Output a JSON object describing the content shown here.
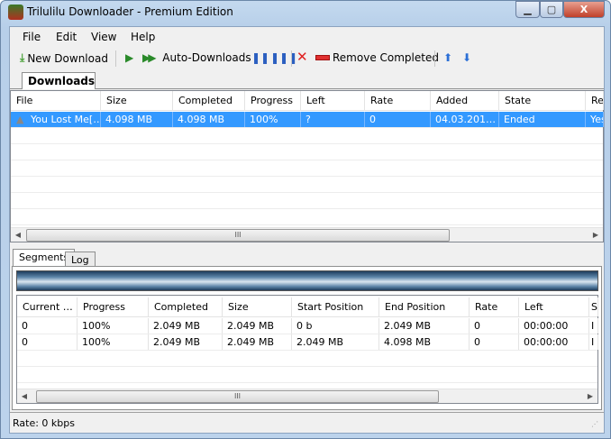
{
  "window": {
    "title": "Trilulilu Downloader - Premium Edition",
    "minimize": "▁",
    "maximize": "▢",
    "close": "X"
  },
  "menu": [
    "File",
    "Edit",
    "View",
    "Help"
  ],
  "toolbar": {
    "new_download": "New Download",
    "auto_downloads": "Auto-Downloads",
    "remove_completed": "Remove Completed"
  },
  "downloads_tab": "Downloads",
  "downloads": {
    "columns": [
      "File",
      "Size",
      "Completed",
      "Progress",
      "Left",
      "Rate",
      "Added",
      "State",
      "Re"
    ],
    "rows": [
      [
        "You Lost Me[…",
        "4.098 MB",
        "4.098 MB",
        "100%",
        "?",
        "0",
        "04.03.201…",
        "Ended",
        "Yes"
      ]
    ]
  },
  "bottom_tabs": [
    "Segments",
    "Log"
  ],
  "segments": {
    "columns": [
      "Current …",
      "Progress",
      "Completed",
      "Size",
      "Start Position",
      "End Position",
      "Rate",
      "Left",
      "S"
    ],
    "rows": [
      [
        "0",
        "100%",
        "2.049 MB",
        "2.049 MB",
        "0 b",
        "2.049 MB",
        "0",
        "00:00:00",
        "I"
      ],
      [
        "0",
        "100%",
        "2.049 MB",
        "2.049 MB",
        "2.049 MB",
        "4.098 MB",
        "0",
        "00:00:00",
        "I"
      ]
    ],
    "progress_percent": 100
  },
  "status": {
    "rate": "Rate:  0 kbps"
  },
  "scroll_grip": "III"
}
